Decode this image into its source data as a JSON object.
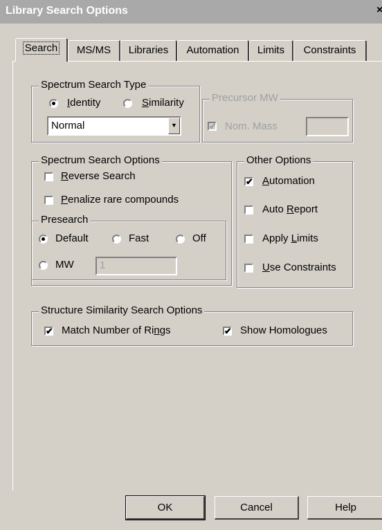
{
  "window": {
    "title": "Library Search Options",
    "close_glyph": "×"
  },
  "tabs": [
    {
      "label": "Search"
    },
    {
      "label": "MS/MS"
    },
    {
      "label": "Libraries"
    },
    {
      "label": "Automation"
    },
    {
      "label": "Limits"
    },
    {
      "label": "Constraints"
    }
  ],
  "spectrum_search_type": {
    "legend": "Spectrum Search Type",
    "identity": {
      "pre": "",
      "accel": "I",
      "post": "dentity",
      "selected": true
    },
    "similarity": {
      "pre": "",
      "accel": "S",
      "post": "imilarity",
      "selected": false
    },
    "mode_value": "Normal"
  },
  "precursor_mw": {
    "legend": "Precursor MW",
    "nom_mass_label": "Nom. Mass",
    "nom_mass_checked": true,
    "nom_mass_value": ""
  },
  "spectrum_search_options": {
    "legend": "Spectrum Search Options",
    "reverse": {
      "pre": "",
      "accel": "R",
      "post": "everse Search",
      "checked": false
    },
    "penalize": {
      "pre": "",
      "accel": "P",
      "post": "enalize rare compounds",
      "checked": false
    },
    "presearch": {
      "legend": "Presearch",
      "default": {
        "label": "Default",
        "selected": true
      },
      "fast": {
        "label": "Fast",
        "selected": false
      },
      "off": {
        "label": "Off",
        "selected": false
      },
      "mw": {
        "label": "MW",
        "selected": false,
        "value": "1"
      }
    }
  },
  "other_options": {
    "legend": "Other Options",
    "automation": {
      "pre": "",
      "accel": "A",
      "post": "utomation",
      "checked": true
    },
    "auto_report": {
      "pre": "Auto ",
      "accel": "R",
      "post": "eport",
      "checked": false
    },
    "apply_limits": {
      "pre": "Apply ",
      "accel": "L",
      "post": "imits",
      "checked": false
    },
    "use_constraints": {
      "pre": "",
      "accel": "U",
      "post": "se Constraints",
      "checked": false
    }
  },
  "structure_similarity": {
    "legend": "Structure Similarity Search Options",
    "match_rings": {
      "pre": "Match Number of Ri",
      "accel": "n",
      "post": "gs",
      "checked": true
    },
    "show_homologues": {
      "pre": "Show Homologue",
      "accel": "",
      "post": "s",
      "checked": true
    }
  },
  "buttons": {
    "ok": "OK",
    "cancel": "Cancel",
    "help": "Help"
  },
  "check_glyph": "✔"
}
